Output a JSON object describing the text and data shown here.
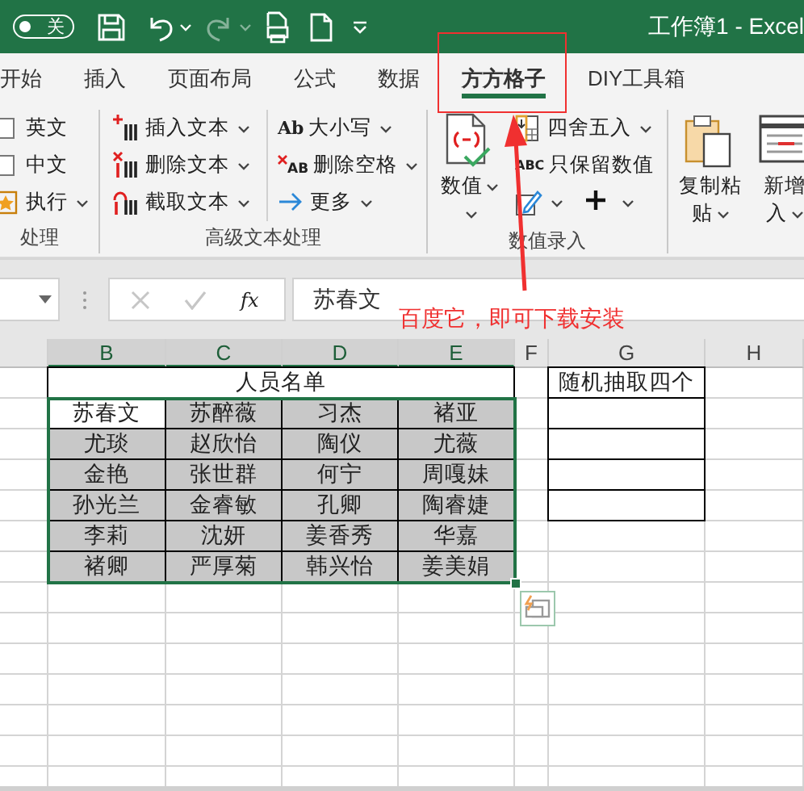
{
  "title_bar": {
    "autosave": {
      "label": "关",
      "on": false
    },
    "redo_disabled": true,
    "title": "工作簿1 - Excel"
  },
  "tabs": [
    {
      "label": "开始",
      "selected": false
    },
    {
      "label": "插入",
      "selected": false
    },
    {
      "label": "页面布局",
      "selected": false
    },
    {
      "label": "公式",
      "selected": false
    },
    {
      "label": "数据",
      "selected": false
    },
    {
      "label": "方方格子",
      "selected": true
    },
    {
      "label": "DIY工具箱",
      "selected": false
    }
  ],
  "ribbon_groups": [
    {
      "label": "处理",
      "items": [
        {
          "kind": "checkbox",
          "label": "英文",
          "checked": false
        },
        {
          "kind": "checkbox",
          "label": "中文",
          "checked": false
        },
        {
          "kind": "menu",
          "label": "执行"
        }
      ]
    },
    {
      "label": "高级文本处理",
      "items": [
        {
          "kind": "menu",
          "label": "插入文本"
        },
        {
          "kind": "menu",
          "label": "删除文本"
        },
        {
          "kind": "menu",
          "label": "截取文本"
        },
        {
          "kind": "menu",
          "label": "大小写",
          "badge": "Ab"
        },
        {
          "kind": "menu",
          "label": "删除空格",
          "badge": "AB"
        },
        {
          "kind": "menu",
          "label": "更多"
        }
      ]
    },
    {
      "label": "数值录入",
      "items": [
        {
          "kind": "large",
          "lines": [
            "数值"
          ]
        },
        {
          "kind": "menu",
          "label": "四舍五入"
        },
        {
          "kind": "button",
          "label": "只保留数值",
          "badge": "ABC"
        },
        {
          "kind": "icon-menu"
        },
        {
          "kind": "icon-menu"
        }
      ]
    },
    {
      "items": [
        {
          "kind": "large",
          "lines": [
            "复制粘",
            "贴"
          ]
        },
        {
          "kind": "large",
          "lines": [
            "新增",
            "入"
          ]
        }
      ]
    }
  ],
  "formula_bar": {
    "function_label": "fx",
    "value": "苏春文"
  },
  "annotation": {
    "text": "百度它，即可下载安装"
  },
  "sheet": {
    "columns": [
      "B",
      "C",
      "D",
      "E",
      "F",
      "G",
      "H"
    ],
    "list_title": "人员名单",
    "side_title": "随机抽取四个",
    "rows": [
      {
        "cells": [
          {
            "text": "苏春文",
            "active": true
          },
          {
            "text": "苏醉薇",
            "active": false
          },
          {
            "text": "习杰",
            "active": false
          },
          {
            "text": "褚亚",
            "active": false
          }
        ]
      },
      {
        "cells": [
          {
            "text": "尤琰",
            "active": false
          },
          {
            "text": "赵欣怡",
            "active": false
          },
          {
            "text": "陶仪",
            "active": false
          },
          {
            "text": "尤薇",
            "active": false
          }
        ]
      },
      {
        "cells": [
          {
            "text": "金艳",
            "active": false
          },
          {
            "text": "张世群",
            "active": false
          },
          {
            "text": "何宁",
            "active": false
          },
          {
            "text": "周嘎妹",
            "active": false
          }
        ]
      },
      {
        "cells": [
          {
            "text": "孙光兰",
            "active": false
          },
          {
            "text": "金睿敏",
            "active": false
          },
          {
            "text": "孔卿",
            "active": false
          },
          {
            "text": "陶睿婕",
            "active": false
          }
        ]
      },
      {
        "cells": [
          {
            "text": "李莉",
            "active": false
          },
          {
            "text": "沈妍",
            "active": false
          },
          {
            "text": "姜香秀",
            "active": false
          },
          {
            "text": "华嘉",
            "active": false
          }
        ]
      },
      {
        "cells": [
          {
            "text": "褚卿",
            "active": false
          },
          {
            "text": "严厚菊",
            "active": false
          },
          {
            "text": "韩兴怡",
            "active": false
          },
          {
            "text": "姜美娟",
            "active": false
          }
        ]
      }
    ]
  }
}
